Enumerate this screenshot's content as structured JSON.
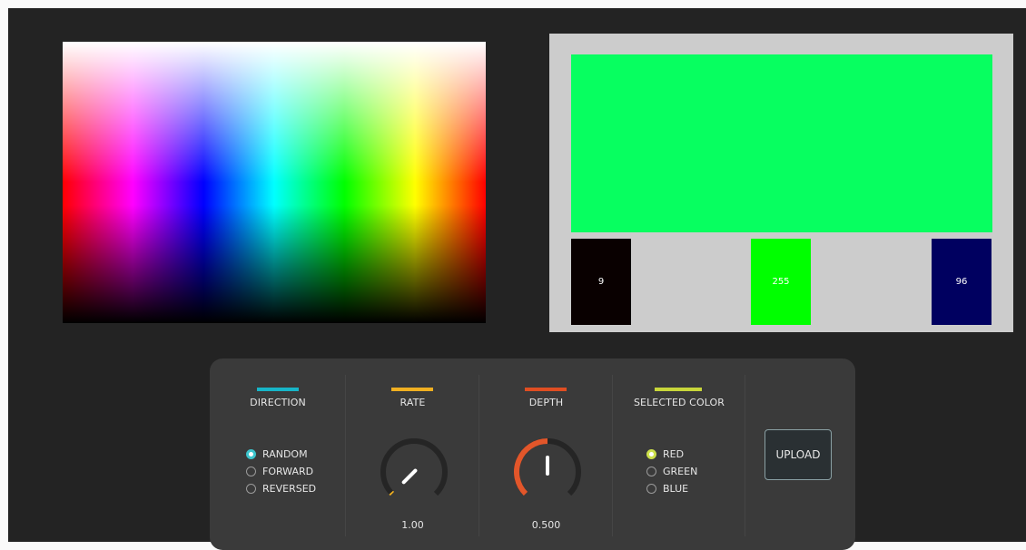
{
  "colors": {
    "preview": "#07ff60",
    "swatch_red": "#090000",
    "swatch_green": "#00ff00",
    "swatch_blue": "#000060",
    "accent_direction": "#17b5c8",
    "accent_rate": "#f0b021",
    "accent_depth": "#e04e22",
    "accent_selected": "#c8d63a",
    "radio_direction_on": "#3cc4cc",
    "radio_selected_on": "#cde04a",
    "knob_rate_arc": "#f0b021",
    "knob_depth_arc": "#e2562a"
  },
  "swatches": {
    "red_value": "9",
    "green_value": "255",
    "blue_value": "96"
  },
  "direction": {
    "title": "DIRECTION",
    "options": [
      "RANDOM",
      "FORWARD",
      "REVERSED"
    ],
    "selected": "RANDOM"
  },
  "rate": {
    "title": "RATE",
    "value_label": "1.00",
    "level": 0.0
  },
  "depth": {
    "title": "DEPTH",
    "value_label": "0.500",
    "level": 0.5
  },
  "selected_color": {
    "title": "SELECTED COLOR",
    "options": [
      "RED",
      "GREEN",
      "BLUE"
    ],
    "selected": "RED"
  },
  "upload": {
    "label": "UPLOAD"
  }
}
